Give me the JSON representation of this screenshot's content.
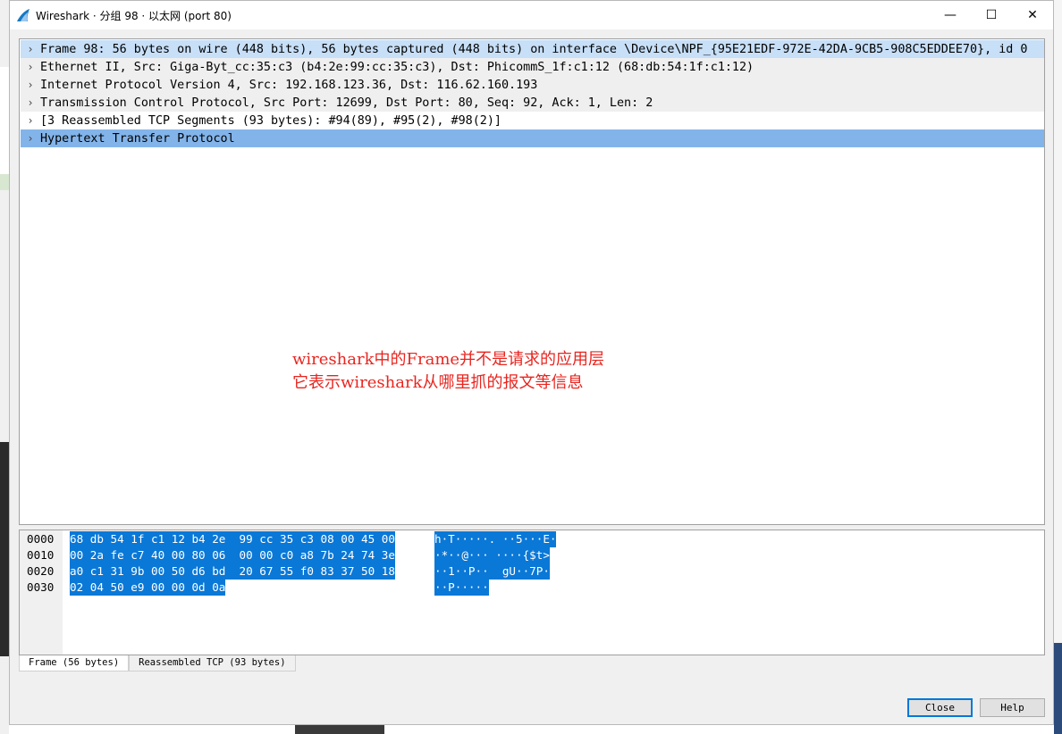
{
  "window": {
    "title": "Wireshark · 分组 98 · 以太网 (port 80)",
    "controls": {
      "minimize": "—",
      "maximize": "☐",
      "close": "✕"
    }
  },
  "tree": {
    "rows": [
      {
        "expander": "›",
        "text": "Frame 98: 56 bytes on wire (448 bits), 56 bytes captured (448 bits) on interface \\Device\\NPF_{95E21EDF-972E-42DA-9CB5-908C5EDDEE70}, id 0"
      },
      {
        "expander": "›",
        "text": "Ethernet II, Src: Giga-Byt_cc:35:c3 (b4:2e:99:cc:35:c3), Dst: PhicommS_1f:c1:12 (68:db:54:1f:c1:12)"
      },
      {
        "expander": "›",
        "text": "Internet Protocol Version 4, Src: 192.168.123.36, Dst: 116.62.160.193"
      },
      {
        "expander": "›",
        "text": "Transmission Control Protocol, Src Port: 12699, Dst Port: 80, Seq: 92, Ack: 1, Len: 2"
      },
      {
        "expander": "›",
        "text": "[3 Reassembled TCP Segments (93 bytes): #94(89), #95(2), #98(2)]"
      },
      {
        "expander": "›",
        "text": "Hypertext Transfer Protocol"
      }
    ]
  },
  "annotation": {
    "line1": "wireshark中的Frame并不是请求的应用层",
    "line2": "它表示wireshark从哪里抓的报文等信息"
  },
  "bytes": {
    "lines": [
      {
        "offset": "0000",
        "hex": "68 db 54 1f c1 12 b4 2e  99 cc 35 c3 08 00 45 00",
        "ascii": "h·T·····. ··5···E·"
      },
      {
        "offset": "0010",
        "hex": "00 2a fe c7 40 00 80 06  00 00 c0 a8 7b 24 74 3e",
        "ascii": "·*··@··· ····{$t>"
      },
      {
        "offset": "0020",
        "hex": "a0 c1 31 9b 00 50 d6 bd  20 67 55 f0 83 37 50 18",
        "ascii": "··1··P··  gU··7P·"
      },
      {
        "offset": "0030",
        "hex": "02 04 50 e9 00 00 0d 0a",
        "ascii": "··P·····"
      }
    ]
  },
  "byte_tabs": [
    "Frame (56 bytes)",
    "Reassembled TCP (93 bytes)"
  ],
  "buttons": {
    "close": "Close",
    "help": "Help"
  },
  "colors": {
    "accent": "#0078d7",
    "byte_highlight": "#0a78d7",
    "row_selected": "#82b4ea",
    "row_focus": "#c7dff7",
    "annotation": "#e8251f"
  }
}
